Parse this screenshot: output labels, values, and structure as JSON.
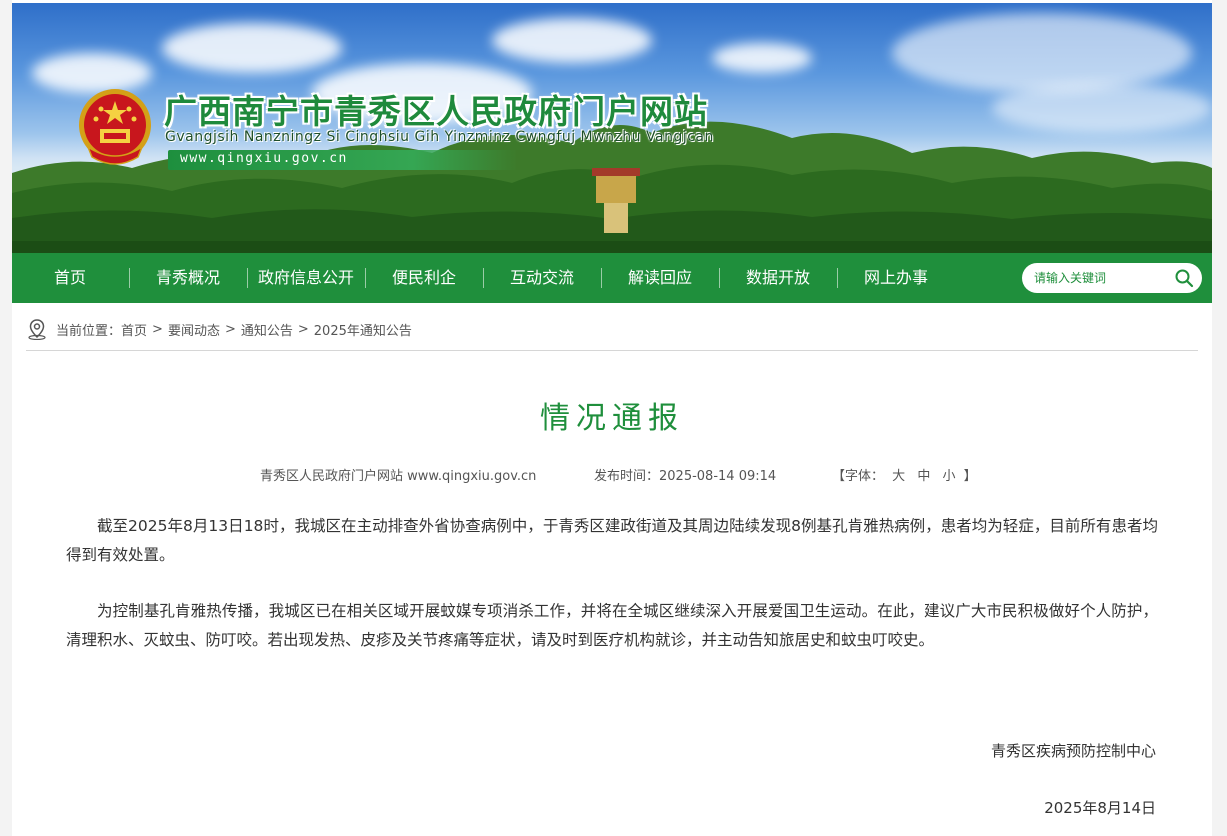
{
  "header": {
    "site_title": "广西南宁市青秀区人民政府门户网站",
    "site_subtitle": "Gvangjsih Nanzningz Si Cinghsiu Gih Yinzminz Cwngfuj Mwnzhu Vangjcan",
    "site_url": "www.qingxiu.gov.cn"
  },
  "nav": {
    "items": [
      "首页",
      "青秀概况",
      "政府信息公开",
      "便民利企",
      "互动交流",
      "解读回应",
      "数据开放",
      "网上办事"
    ],
    "search_placeholder": "请输入关键词"
  },
  "breadcrumb": {
    "prefix": "当前位置：",
    "items": [
      "首页",
      "要闻动态",
      "通知公告",
      "2025年通知公告"
    ],
    "separator": ">"
  },
  "article": {
    "title": "情况通报",
    "source": "青秀区人民政府门户网站 www.qingxiu.gov.cn",
    "publish_label": "发布时间：",
    "publish_time": "2025-08-14 09:14",
    "font_label": "【字体：",
    "font_sizes": [
      "大",
      "中",
      "小"
    ],
    "font_close": "】",
    "paragraphs": [
      "截至2025年8月13日18时，我城区在主动排查外省协查病例中，于青秀区建政街道及其周边陆续发现8例基孔肯雅热病例，患者均为轻症，目前所有患者均得到有效处置。",
      "为控制基孔肯雅热传播，我城区已在相关区域开展蚊媒专项消杀工作，并将在全城区继续深入开展爱国卫生运动。在此，建议广大市民积极做好个人防护，清理积水、灭蚊虫、防叮咬。若出现发热、皮疹及关节疼痛等症状，请及时到医疗机构就诊，并主动告知旅居史和蚊虫叮咬史。"
    ],
    "signature": "青秀区疾病预防控制中心",
    "date": "2025年8月14日"
  },
  "colors": {
    "brand_green": "#1f8f3c",
    "nav_background": "#1f8f3c",
    "page_background": "#f3f3f3"
  }
}
